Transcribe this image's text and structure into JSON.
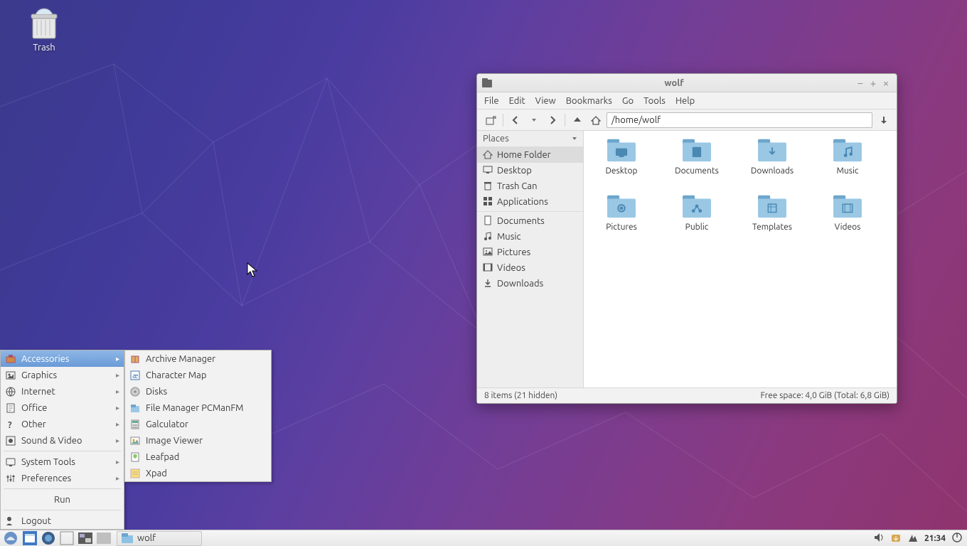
{
  "desktop": {
    "trash_label": "Trash"
  },
  "menu": {
    "main": [
      {
        "id": "accessories",
        "label": "Accessories",
        "sel": true,
        "arrow": true
      },
      {
        "id": "graphics",
        "label": "Graphics",
        "arrow": true
      },
      {
        "id": "internet",
        "label": "Internet",
        "arrow": true
      },
      {
        "id": "office",
        "label": "Office",
        "arrow": true
      },
      {
        "id": "other",
        "label": "Other",
        "arrow": true
      },
      {
        "id": "sound-video",
        "label": "Sound & Video",
        "arrow": true
      }
    ],
    "main2": [
      {
        "id": "system-tools",
        "label": "System Tools",
        "arrow": true
      },
      {
        "id": "preferences",
        "label": "Preferences",
        "arrow": true
      }
    ],
    "run_label": "Run",
    "logout_label": "Logout",
    "sub": [
      {
        "id": "archive-manager",
        "label": "Archive Manager"
      },
      {
        "id": "character-map",
        "label": "Character Map"
      },
      {
        "id": "disks",
        "label": "Disks"
      },
      {
        "id": "filemanager",
        "label": "File Manager PCManFM"
      },
      {
        "id": "galculator",
        "label": "Galculator"
      },
      {
        "id": "image-viewer",
        "label": "Image Viewer"
      },
      {
        "id": "leafpad",
        "label": "Leafpad"
      },
      {
        "id": "xpad",
        "label": "Xpad"
      }
    ]
  },
  "panel": {
    "task_label": "wolf",
    "clock": "21:34"
  },
  "fm": {
    "title": "wolf",
    "menubar": [
      "File",
      "Edit",
      "View",
      "Bookmarks",
      "Go",
      "Tools",
      "Help"
    ],
    "path": "/home/wolf",
    "places_header": "Places",
    "places": [
      "Home Folder",
      "Desktop",
      "Trash Can",
      "Applications"
    ],
    "bookmarks": [
      "Documents",
      "Music",
      "Pictures",
      "Videos",
      "Downloads"
    ],
    "folders": [
      "Desktop",
      "Documents",
      "Downloads",
      "Music",
      "Pictures",
      "Public",
      "Templates",
      "Videos"
    ],
    "status_left": "8 items (21 hidden)",
    "status_right": "Free space: 4,0 GiB (Total: 6,8 GiB)"
  }
}
